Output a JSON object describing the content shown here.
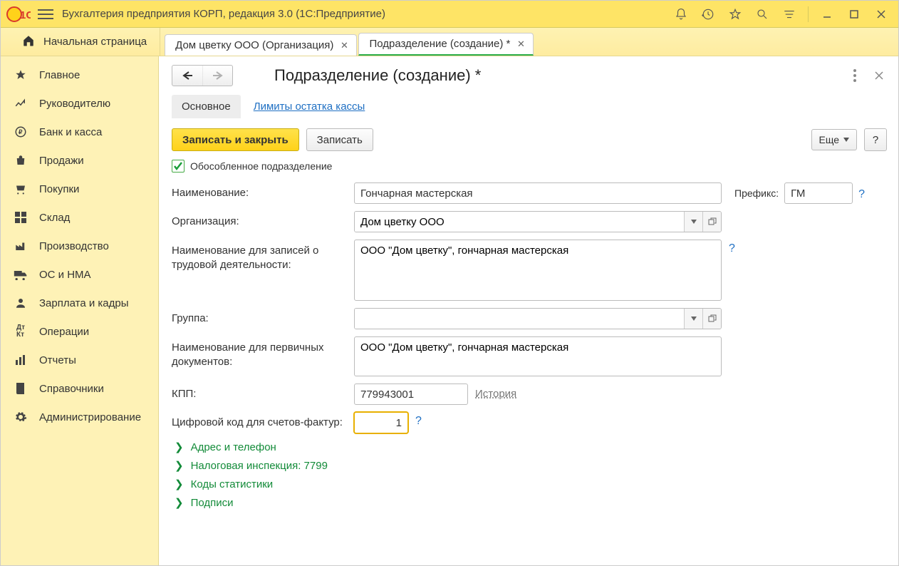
{
  "app": {
    "title": "Бухгалтерия предприятия КОРП, редакция 3.0  (1С:Предприятие)"
  },
  "tabs": {
    "home": "Начальная страница",
    "t0": "Дом цветку ООО (Организация)",
    "t1": "Подразделение (создание) *"
  },
  "sidebar": {
    "items": [
      {
        "label": "Главное"
      },
      {
        "label": "Руководителю"
      },
      {
        "label": "Банк и касса"
      },
      {
        "label": "Продажи"
      },
      {
        "label": "Покупки"
      },
      {
        "label": "Склад"
      },
      {
        "label": "Производство"
      },
      {
        "label": "ОС и НМА"
      },
      {
        "label": "Зарплата и кадры"
      },
      {
        "label": "Операции"
      },
      {
        "label": "Отчеты"
      },
      {
        "label": "Справочники"
      },
      {
        "label": "Администрирование"
      }
    ]
  },
  "page": {
    "title": "Подразделение (создание) *",
    "inner_tabs": {
      "main": "Основное",
      "limits": "Лимиты остатка кассы"
    },
    "buttons": {
      "save_close": "Записать и закрыть",
      "save": "Записать",
      "more": "Еще",
      "help": "?"
    },
    "chk_label": "Обособленное подразделение"
  },
  "form": {
    "name_label": "Наименование:",
    "name_value": "Гончарная мастерская",
    "prefix_label": "Префикс:",
    "prefix_value": "ГМ",
    "org_label": "Организация:",
    "org_value": "Дом цветку ООО",
    "fullname_label": "Наименование для записей о трудовой деятельности:",
    "fullname_value": "ООО \"Дом цветку\", гончарная мастерская",
    "group_label": "Группа:",
    "group_value": "",
    "docname_label": "Наименование для первичных документов:",
    "docname_value": "ООО \"Дом цветку\", гончарная мастерская",
    "kpp_label": "КПП:",
    "kpp_value": "779943001",
    "kpp_history": "История",
    "code_label": "Цифровой код для счетов-фактур:",
    "code_value": "1"
  },
  "expand": {
    "addr": "Адрес и телефон",
    "tax": "Налоговая инспекция: 7799",
    "stat": "Коды статистики",
    "sign": "Подписи"
  }
}
